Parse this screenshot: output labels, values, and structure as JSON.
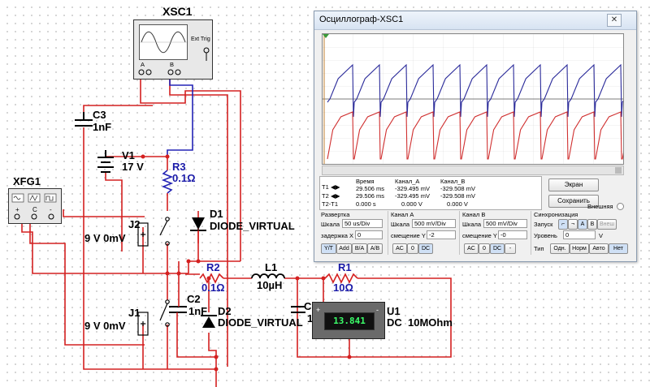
{
  "schematic": {
    "xsc1": {
      "label": "XSC1",
      "ext_trig": "Ext Trig",
      "term_a": "A",
      "term_b": "B"
    },
    "xfg1": {
      "label": "XFG1"
    },
    "c3": {
      "name": "C3",
      "value": "1nF"
    },
    "v1": {
      "name": "V1",
      "value": "17 V"
    },
    "r3": {
      "name": "R3",
      "value": "0.1Ω"
    },
    "d1": {
      "name": "D1",
      "value": "DIODE_VIRTUAL"
    },
    "j2": {
      "name": "J2",
      "value": "9 V 0mV"
    },
    "j1": {
      "name": "J1",
      "value": "9 V 0mV"
    },
    "r2": {
      "name": "R2",
      "value": "0.1Ω"
    },
    "l1": {
      "name": "L1",
      "value": "10µH"
    },
    "r1": {
      "name": "R1",
      "value": "10Ω"
    },
    "c2": {
      "name": "C2",
      "value": "1nF"
    },
    "d2": {
      "name": "D2",
      "value": "DIODE_VIRTUAL"
    },
    "c1": {
      "name": "C1",
      "value": "10"
    },
    "u1": {
      "name": "U1",
      "mode": "DC",
      "resistance": "10MOhm",
      "reading": "13.841"
    }
  },
  "oscilloscope": {
    "title": "Осциллограф-XSC1",
    "cursor_table": {
      "headers": [
        "Время",
        "Канал_A",
        "Канал_B"
      ],
      "rows": [
        {
          "label": "T1",
          "time": "29.506 ms",
          "a": "-329.495 mV",
          "b": "-329.508 mV"
        },
        {
          "label": "T2",
          "time": "29.506 ms",
          "a": "-329.495 mV",
          "b": "-329.508 mV"
        },
        {
          "label": "T2-T1",
          "time": "0.000 s",
          "a": "0.000 V",
          "b": "0.000 V"
        }
      ]
    },
    "buttons": {
      "screen": "Экран",
      "save": "Сохранить",
      "external": "Внешняя"
    },
    "timebase": {
      "title": "Развертка",
      "scale_label": "Шкала",
      "scale": "50 us/Div",
      "xpos_label": "задержка X",
      "xpos": "0",
      "modes": [
        "Y/T",
        "Add",
        "B/A",
        "A/B"
      ]
    },
    "channel_a": {
      "title": "Канал A",
      "scale_label": "Шкала",
      "scale": "500 mV/Div",
      "ypos_label": "смещение Y",
      "ypos": "-2",
      "modes": [
        "AC",
        "0",
        "DC"
      ]
    },
    "channel_b": {
      "title": "Канал B",
      "scale_label": "Шкала",
      "scale": "500 mV/Div",
      "ypos_label": "смещение Y",
      "ypos": "-0",
      "modes": [
        "AC",
        "0",
        "DC",
        "-"
      ]
    },
    "trigger": {
      "title": "Синхронизация",
      "edge_label": "Запуск",
      "level_label": "Уровень",
      "level": "0",
      "unit": "V",
      "type_label": "Тип",
      "sources": [
        "A",
        "B",
        "Внеш"
      ],
      "types": [
        "Одн.",
        "Норм",
        "Авто",
        "Нет"
      ]
    },
    "trace_colors": {
      "channel_a": "#d03030",
      "channel_b": "#2b2b9a"
    }
  }
}
